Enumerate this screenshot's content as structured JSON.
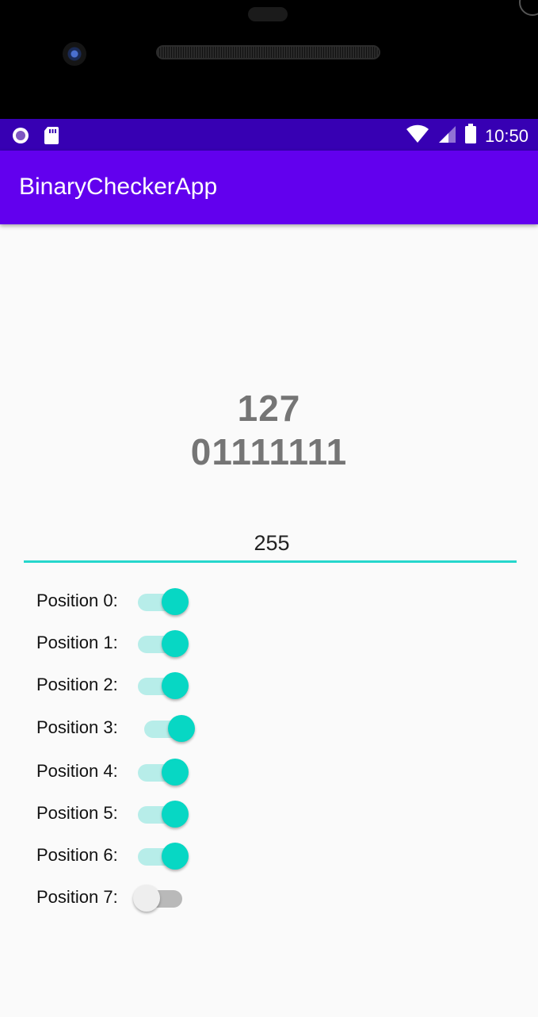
{
  "app": {
    "title": "BinaryCheckerApp"
  },
  "status_bar": {
    "time": "10:50"
  },
  "display": {
    "decimal": "127",
    "binary": "01111111"
  },
  "input": {
    "value": "255"
  },
  "switches": [
    {
      "label": "Position 0:",
      "on": true
    },
    {
      "label": "Position 1:",
      "on": true
    },
    {
      "label": "Position 2:",
      "on": true
    },
    {
      "label": "Position 3:",
      "on": true
    },
    {
      "label": "Position 4:",
      "on": true
    },
    {
      "label": "Position 5:",
      "on": true
    },
    {
      "label": "Position 6:",
      "on": true
    },
    {
      "label": "Position 7:",
      "on": false
    }
  ],
  "colors": {
    "status_bar": "#3700b3",
    "app_bar": "#6200ee",
    "accent": "#07d7c4"
  }
}
